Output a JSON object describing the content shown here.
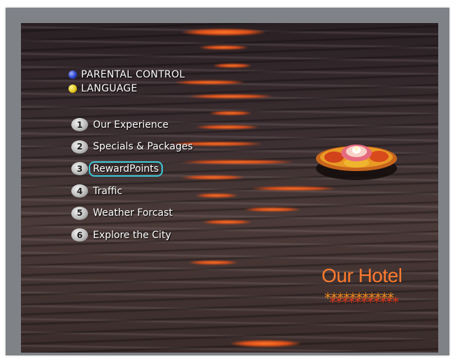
{
  "options": [
    {
      "label": "PARENTAL CONTROL",
      "icon": "blue-button-icon",
      "color": "#2c43c9"
    },
    {
      "label": "LANGUAGE",
      "icon": "yellow-button-icon",
      "color": "#e5c91c"
    }
  ],
  "menu": {
    "selected_index": 2,
    "items": [
      {
        "number": "1",
        "label": "Our Experience"
      },
      {
        "number": "2",
        "label": "Specials & Packages"
      },
      {
        "number": "3",
        "label": "RewardPoints"
      },
      {
        "number": "4",
        "label": "Traffic"
      },
      {
        "number": "5",
        "label": "Weather Forcast"
      },
      {
        "number": "6",
        "label": "Explore the City"
      }
    ]
  },
  "branding": {
    "title": "Our Hotel",
    "stars": "***********",
    "title_color": "#ff7a2e",
    "highlight_color": "#3ec9d9"
  }
}
